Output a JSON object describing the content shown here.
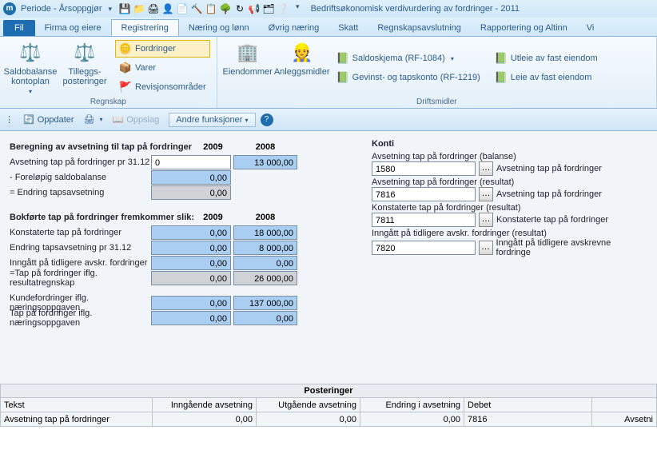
{
  "titlebar": {
    "period": "Periode - Årsoppgjør",
    "title": "Bedriftsøkonomisk verdivurdering av fordringer - 2011"
  },
  "tabs": {
    "file": "Fil",
    "items": [
      "Firma og eiere",
      "Registrering",
      "Næring og lønn",
      "Øvrig næring",
      "Skatt",
      "Regnskapsavslutning",
      "Rapportering og Altinn",
      "Vi"
    ],
    "active": 1
  },
  "ribbon": {
    "g1": {
      "label": "Regnskap",
      "big1": "Saldobalanse kontoplan",
      "big2": "Tilleggs-posteringer",
      "sm1": "Fordringer",
      "sm2": "Varer",
      "sm3": "Revisjonsområder"
    },
    "g2": {
      "big1": "Eiendommer",
      "big2": "Anleggsmidler",
      "sm1": "Saldoskjema (RF-1084)",
      "sm2": "Gevinst- og tapskonto (RF-1219)",
      "sm3": "Utleie av fast eiendom",
      "sm4": "Leie av fast eiendom",
      "label": "Driftsmidler"
    }
  },
  "subbar": {
    "oppdater": "Oppdater",
    "oppslag": "Oppslag",
    "andre": "Andre funksjoner"
  },
  "calc": {
    "heading": "Beregning av avsetning til tap på fordringer",
    "y1": "2009",
    "y2": "2008",
    "r1": {
      "lbl": "Avsetning tap på fordringer pr 31.12",
      "a": "0",
      "b": "13 000,00"
    },
    "r2": {
      "lbl": "- Foreløpig saldobalanse",
      "a": "0,00"
    },
    "r3": {
      "lbl": "= Endring tapsavsetning",
      "a": "0,00"
    },
    "h2": "Bokførte tap på fordringer fremkommer slik:",
    "r4": {
      "lbl": "Konstaterte tap på fordringer",
      "a": "0,00",
      "b": "18 000,00"
    },
    "r5": {
      "lbl": "Endring tapsavsetning pr 31.12",
      "a": "0,00",
      "b": "8 000,00"
    },
    "r6": {
      "lbl": "Inngått på tidligere avskr. fordringer",
      "a": "0,00",
      "b": "0,00"
    },
    "r7": {
      "lbl": "=Tap på fordringer iflg. resultatregnskap",
      "a": "0,00",
      "b": "26 000,00"
    },
    "r8": {
      "lbl": "Kundefordringer iflg. næringsoppgaven",
      "a": "0,00",
      "b": "137 000,00"
    },
    "r9": {
      "lbl": "Tap på fordringer iflg. næringsoppgaven",
      "a": "0,00",
      "b": "0,00"
    }
  },
  "konti": {
    "heading": "Konti",
    "f1": {
      "lbl": "Avsetning tap på fordringer (balanse)",
      "val": "1580",
      "desc": "Avsetning tap på fordringer"
    },
    "f2": {
      "lbl": "Avsetning tap på fordringer (resultat)",
      "val": "7816",
      "desc": "Avsetning tap på fordringer"
    },
    "f3": {
      "lbl": "Konstaterte tap på fordringer (resultat)",
      "val": "7811",
      "desc": "Konstaterte tap på fordringer"
    },
    "f4": {
      "lbl": "Inngått på tidligere avskr. fordringer (resultat)",
      "val": "7820",
      "desc": "Inngått på tidligere avskrevne fordringe"
    }
  },
  "grid": {
    "title": "Posteringer",
    "cols": [
      "Tekst",
      "Inngående avsetning",
      "Utgående avsetning",
      "Endring i avsetning",
      "Debet",
      ""
    ],
    "row": {
      "tekst": "Avsetning tap på fordringer",
      "inn": "0,00",
      "ut": "0,00",
      "end": "0,00",
      "debet": "7816",
      "last": "Avsetni"
    }
  }
}
